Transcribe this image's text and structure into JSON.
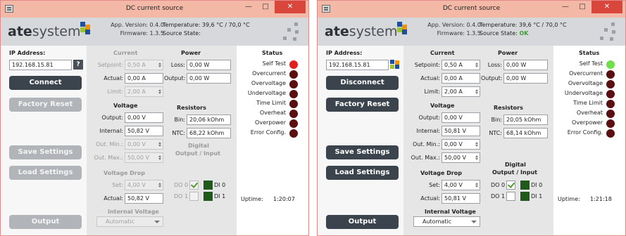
{
  "windows": [
    {
      "title": "DC current source",
      "header": {
        "logo": "atesystem",
        "app_version_label": "App. Version:",
        "app_version": "0.4.0",
        "firmware_label": "Firmware:",
        "firmware": "1.3.5",
        "temperature_label": "Temperature:",
        "temperature": "39,6 °C / 70,0 °C",
        "source_state_label": "Source State:",
        "source_state": ""
      },
      "left": {
        "ip_label": "IP Address:",
        "ip_value": "192.168.15.81",
        "help_icon": "?",
        "connect_button": "Connect",
        "factory_reset": "Factory Reset",
        "save_settings": "Save Settings",
        "load_settings": "Load Settings",
        "output": "Output"
      },
      "current": {
        "heading": "Current",
        "setpoint_label": "Setpoint:",
        "setpoint": "0,50 A",
        "actual_label": "Actual:",
        "actual": "0,00 A",
        "limit_label": "Limit:",
        "limit": "2,00 A"
      },
      "power": {
        "heading": "Power",
        "loss_label": "Loss:",
        "loss": "0,00 W",
        "output_label": "Output:",
        "output": "0,00 W"
      },
      "voltage": {
        "heading": "Voltage",
        "output_label": "Output:",
        "output": "0,00 V",
        "internal_label": "Internal:",
        "internal": "50,82 V",
        "out_min_label": "Out. Min.:",
        "out_min": "0,00 V",
        "out_max_label": "Out. Max.:",
        "out_max": "50,00 V"
      },
      "resistors": {
        "heading": "Resistors",
        "bin_label": "Bin:",
        "bin": "20,06 kOhm",
        "ntc_label": "NTC:",
        "ntc": "68,22 kOhm"
      },
      "voltage_drop": {
        "heading": "Voltage Drop",
        "set_label": "Set:",
        "set": "4,00 V",
        "actual_label": "Actual:",
        "actual": "50,82 V"
      },
      "digital": {
        "heading1": "Digital",
        "heading2": "Output  / Input",
        "do0": "DO 0",
        "do1": "DO 1",
        "di0": "DI 0",
        "di1": "DI 1"
      },
      "internal_voltage": {
        "heading": "Internal Voltage",
        "value": "Automatic"
      },
      "status": {
        "heading": "Status",
        "items": [
          "Self Test",
          "Overcurrent",
          "Overvoltage",
          "Undervoltage",
          "Time Limit",
          "Overheat",
          "Overpower",
          "Error Config."
        ],
        "uptime_label": "Uptime:",
        "uptime": "1:20:07"
      }
    },
    {
      "title": "DC current source",
      "header": {
        "logo": "atesystem",
        "app_version_label": "App. Version:",
        "app_version": "0.4.0",
        "firmware_label": "Firmware:",
        "firmware": "1.3.5",
        "temperature_label": "Temperature:",
        "temperature": "39,6 °C / 70,0 °C",
        "source_state_label": "Source State:",
        "source_state": "OK"
      },
      "left": {
        "ip_label": "IP Address:",
        "ip_value": "192.168.15.81",
        "connect_button": "Disconnect",
        "factory_reset": "Factory Reset",
        "save_settings": "Save Settings",
        "load_settings": "Load Settings",
        "output": "Output"
      },
      "current": {
        "heading": "Current",
        "setpoint_label": "Setpoint:",
        "setpoint": "0,50 A",
        "actual_label": "Actual:",
        "actual": "0,00 A",
        "limit_label": "Limit:",
        "limit": "2,00 A"
      },
      "power": {
        "heading": "Power",
        "loss_label": "Loss:",
        "loss": "0,00 W",
        "output_label": "Output:",
        "output": "0,00 W"
      },
      "voltage": {
        "heading": "Voltage",
        "output_label": "Output:",
        "output": "0,00 V",
        "internal_label": "Internal:",
        "internal": "50,81 V",
        "out_min_label": "Out. Min.:",
        "out_min": "0,00 V",
        "out_max_label": "Out. Max.:",
        "out_max": "50,00 V"
      },
      "resistors": {
        "heading": "Resistors",
        "bin_label": "Bin:",
        "bin": "20,05 kOhm",
        "ntc_label": "NTC:",
        "ntc": "68,14 kOhm"
      },
      "voltage_drop": {
        "heading": "Voltage Drop",
        "set_label": "Set:",
        "set": "4,00 V",
        "actual_label": "Actual:",
        "actual": "50,81 V"
      },
      "digital": {
        "heading1": "Digital",
        "heading2": "Output  / Input",
        "do0": "DO 0",
        "do1": "DO 1",
        "di0": "DI 0",
        "di1": "DI 1"
      },
      "internal_voltage": {
        "heading": "Internal Voltage",
        "value": "Automatic"
      },
      "status": {
        "heading": "Status",
        "items": [
          "Self Test",
          "Overcurrent",
          "Overvoltage",
          "Undervoltage",
          "Time Limit",
          "Overheat",
          "Overpower",
          "Error Config."
        ],
        "uptime_label": "Uptime:",
        "uptime": "1:21:18"
      }
    }
  ],
  "colors": {
    "title_bar": "#f3b9a6",
    "close": "#d9463b",
    "header": "#d6d8db",
    "button_dark": "#3b434c",
    "button_disabled": "#b1b5ba",
    "led_off": "#5a1010",
    "led_red": "#e02020",
    "led_green": "#6fe04a",
    "source_ok": "#38a12e"
  },
  "icons": [
    "app-icon",
    "minimize-icon",
    "maximize-icon",
    "close-icon",
    "help-icon",
    "puzzle-icon",
    "spin-arrows-icon",
    "dropdown-arrow-icon",
    "checkmark-icon"
  ]
}
